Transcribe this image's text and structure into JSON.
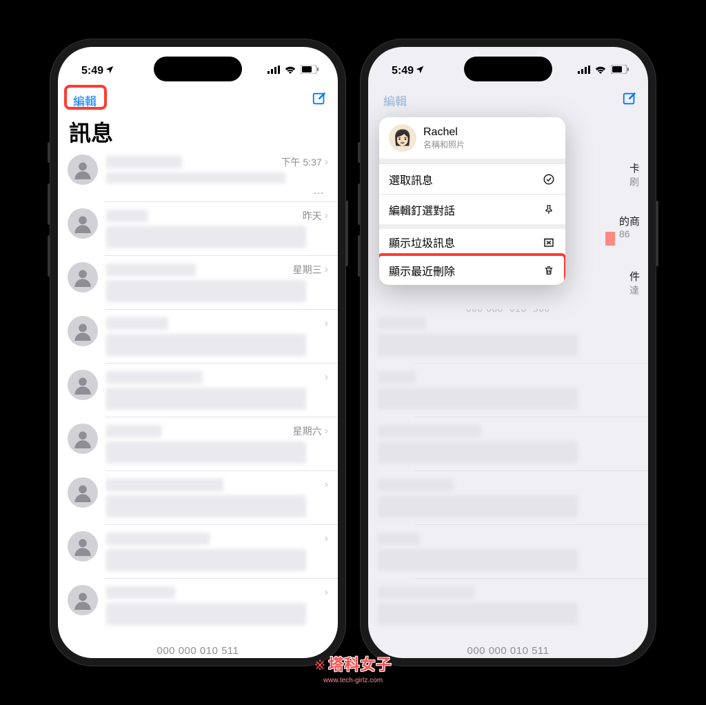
{
  "status": {
    "time": "5:49"
  },
  "nav": {
    "edit": "編輯"
  },
  "title": "訊息",
  "rows": [
    {
      "time": "下午 5:37"
    },
    {
      "time": "昨天"
    },
    {
      "time": "星期三"
    },
    {
      "time": ""
    },
    {
      "time": ""
    },
    {
      "time": "星期六"
    },
    {
      "time": ""
    },
    {
      "time": ""
    },
    {
      "time": ""
    }
  ],
  "popover": {
    "name": "Rachel",
    "subtitle": "名稱和照片",
    "items": [
      {
        "label": "選取訊息"
      },
      {
        "label": "編輯釘選對話"
      },
      {
        "label": "顯示垃圾訊息"
      },
      {
        "label": "顯示最近刪除"
      }
    ]
  },
  "bg_peek": {
    "r1a": "卡",
    "r1b": "刷",
    "r2a": "的商",
    "r2b": "86",
    "r3a": "件",
    "r3b": "達"
  },
  "bottom_number": "000 000  010  511",
  "watermark": {
    "text": "塔科女子",
    "url": "www.tech-girlz.com"
  }
}
